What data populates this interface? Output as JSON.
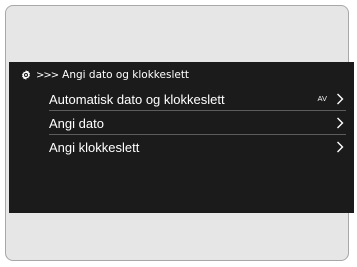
{
  "header": {
    "settings_icon": "gear-icon",
    "breadcrumb_arrows": ">>>",
    "title": "Angi dato og klokkeslett"
  },
  "menu": {
    "items": [
      {
        "label": "Automatisk dato og klokkeslett",
        "state": "AV",
        "icon": "chevron-right-icon"
      },
      {
        "label": "Angi dato",
        "icon": "chevron-right-icon"
      },
      {
        "label": "Angi klokkeslett",
        "icon": "chevron-right-icon"
      }
    ]
  },
  "colors": {
    "screen_bg": "#1b1b1b",
    "bezel_bg": "#e6e6e6",
    "text": "#ffffff",
    "divider": "#5c5c5c"
  }
}
